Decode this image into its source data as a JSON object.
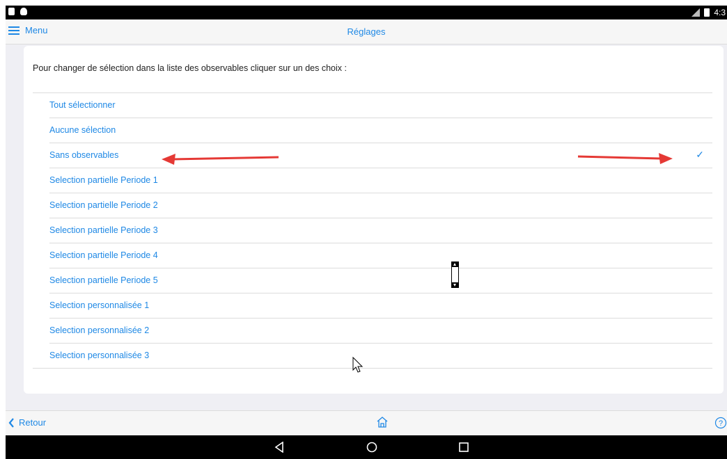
{
  "statusbar": {
    "time": "4:3"
  },
  "topbar": {
    "menu_label": "Menu",
    "title": "Réglages"
  },
  "instruction": "Pour changer de sélection dans la liste des observables cliquer sur un des choix :",
  "list": [
    {
      "label": "Tout sélectionner",
      "checked": false
    },
    {
      "label": "Aucune sélection",
      "checked": false
    },
    {
      "label": "Sans observables",
      "checked": true
    },
    {
      "label": "Selection partielle Periode 1",
      "checked": false
    },
    {
      "label": "Selection partielle Periode 2",
      "checked": false
    },
    {
      "label": "Selection partielle Periode 3",
      "checked": false
    },
    {
      "label": "Selection partielle Periode 4",
      "checked": false
    },
    {
      "label": "Selection partielle Periode 5",
      "checked": false
    },
    {
      "label": "Selection personnalisée 1",
      "checked": false
    },
    {
      "label": "Selection personnalisée 2",
      "checked": false
    },
    {
      "label": "Selection personnalisée 3",
      "checked": false
    }
  ],
  "bottombar": {
    "back_label": "Retour"
  },
  "icons": {
    "menu": "hamburger-icon",
    "check": "checkmark-icon",
    "back": "chevron-left-icon",
    "home": "home-icon",
    "help": "help-icon",
    "nav_back": "nav-back-icon",
    "nav_home": "nav-home-icon",
    "nav_recents": "nav-recents-icon"
  },
  "colors": {
    "accent": "#1e88e5",
    "arrow": "#e53935",
    "background": "#efeff4"
  }
}
